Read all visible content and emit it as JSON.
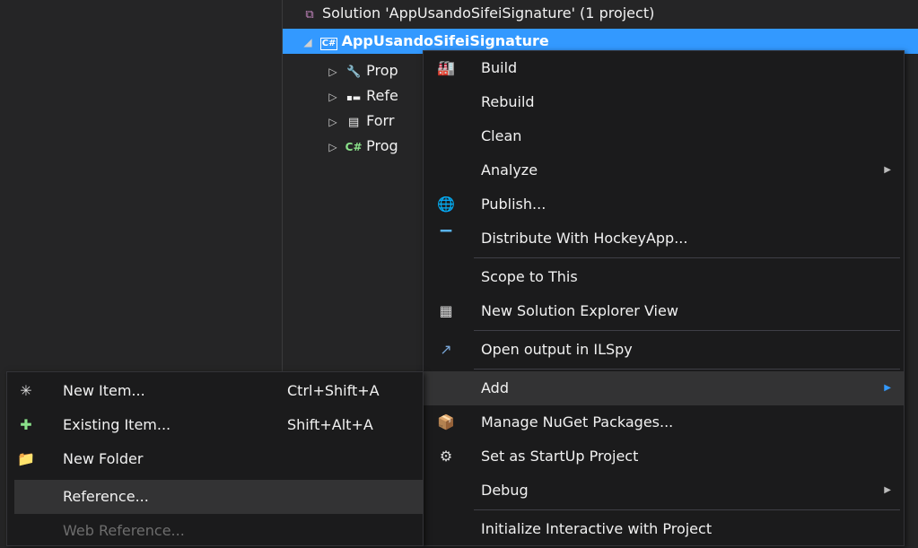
{
  "tree": {
    "solution_label": "Solution 'AppUsandoSifeiSignature' (1 project)",
    "project_label": "AppUsandoSifeiSignature",
    "cs_badge": "C#",
    "children": [
      {
        "label": "Prop",
        "icon": "wrench-icon"
      },
      {
        "label": "Refe",
        "icon": "references-icon"
      },
      {
        "label": "Forr",
        "icon": "form-icon"
      },
      {
        "label": "Prog",
        "icon": "csharp-file-icon",
        "badge": "C#"
      }
    ]
  },
  "context_menu": {
    "items": [
      {
        "label": "Build",
        "icon": "build-icon"
      },
      {
        "label": "Rebuild"
      },
      {
        "label": "Clean"
      },
      {
        "label": "Analyze",
        "submenu": true
      },
      {
        "label": "Publish...",
        "icon": "publish-icon"
      },
      {
        "label": "Distribute With HockeyApp...",
        "icon": "hockeyapp-icon"
      },
      {
        "label": "Scope to This"
      },
      {
        "label": "New Solution Explorer View",
        "icon": "solution-explorer-view-icon"
      },
      {
        "label": "Open output in ILSpy",
        "icon": "ilspy-icon"
      },
      {
        "label": "Add",
        "submenu": true,
        "highlighted": true
      },
      {
        "label": "Manage NuGet Packages...",
        "icon": "nuget-icon"
      },
      {
        "label": "Set as StartUp Project",
        "icon": "gear-icon"
      },
      {
        "label": "Debug",
        "submenu": true
      },
      {
        "label": "Initialize Interactive with Project"
      }
    ]
  },
  "add_submenu": {
    "items": [
      {
        "label": "New Item...",
        "shortcut": "Ctrl+Shift+A",
        "icon": "new-item-icon"
      },
      {
        "label": "Existing Item...",
        "shortcut": "Shift+Alt+A",
        "icon": "existing-item-icon"
      },
      {
        "label": "New Folder",
        "icon": "new-folder-icon"
      },
      {
        "label": "Reference...",
        "highlighted": true
      },
      {
        "label": "Web Reference...",
        "disabled": true
      }
    ]
  },
  "colors": {
    "background": "#252526",
    "selection": "#3399ff",
    "menu_background": "#1b1b1c",
    "menu_highlight": "#333334",
    "submenu_arrow_active": "#3399ff"
  }
}
